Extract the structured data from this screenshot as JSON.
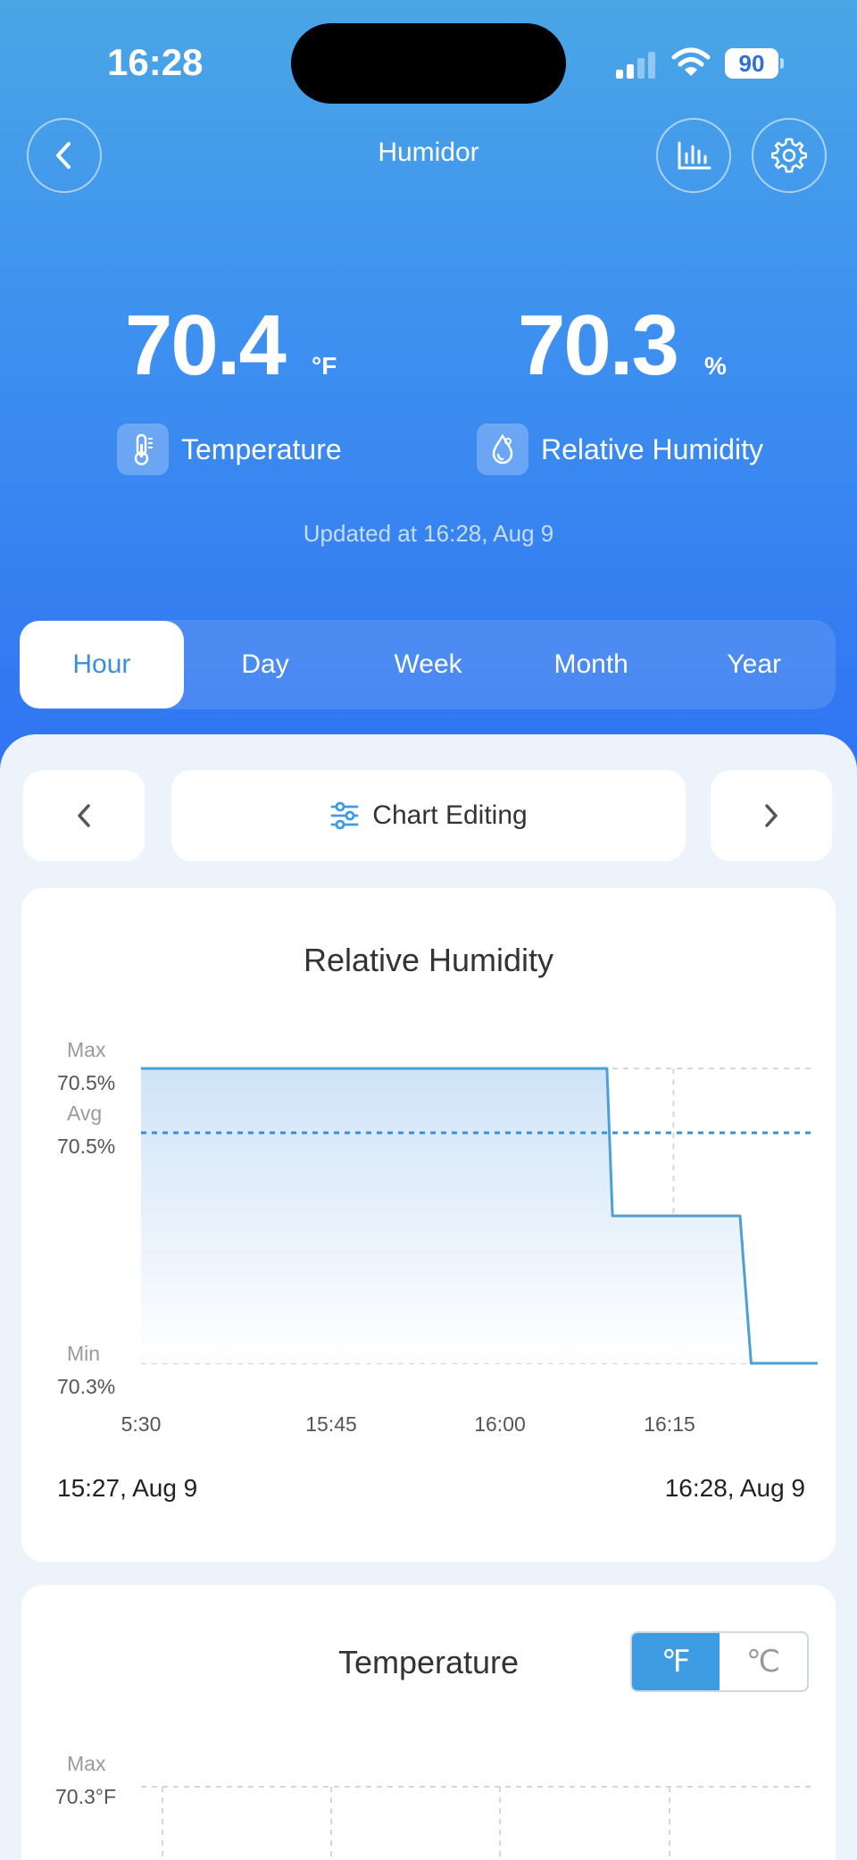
{
  "status_bar": {
    "time": "16:28",
    "battery": "90"
  },
  "nav": {
    "title": "Humidor",
    "icons": [
      "chevron-left-icon",
      "bar-chart-icon",
      "gear-icon"
    ]
  },
  "readings": {
    "temperature": {
      "value": "70.4",
      "unit": "°F",
      "label": "Temperature"
    },
    "humidity": {
      "value": "70.3",
      "unit": "%",
      "label": "Relative Humidity"
    }
  },
  "updated_text": "Updated at 16:28,  Aug 9",
  "tabs": [
    {
      "label": "Hour",
      "active": true
    },
    {
      "label": "Day",
      "active": false
    },
    {
      "label": "Week",
      "active": false
    },
    {
      "label": "Month",
      "active": false
    },
    {
      "label": "Year",
      "active": false
    }
  ],
  "toolbar": {
    "chart_editing_label": "Chart Editing"
  },
  "humidity_card": {
    "title": "Relative Humidity",
    "max_label": "Max",
    "max_value": "70.5%",
    "avg_label": "Avg",
    "avg_value": "70.5%",
    "min_label": "Min",
    "min_value": "70.3%",
    "start": "15:27,  Aug 9",
    "end": "16:28,  Aug 9"
  },
  "temperature_card": {
    "title": "Temperature",
    "unit_f": "℉",
    "unit_c": "℃",
    "max_label": "Max",
    "max_value": "70.3°F"
  },
  "colors": {
    "accent": "#3d9ce2",
    "hero_top": "#4aa6e6",
    "hero_bottom": "#2f73f2",
    "line": "#4aa0d8"
  },
  "chart_data": {
    "type": "line",
    "title": "Relative Humidity",
    "xlabel": "",
    "ylabel": "",
    "x_ticks": [
      "5:30",
      "15:45",
      "16:00",
      "16:15"
    ],
    "x": [
      "15:27",
      "16:09",
      "16:09.5",
      "16:21",
      "16:22",
      "16:28"
    ],
    "y": [
      70.5,
      70.5,
      70.4,
      70.4,
      70.3,
      70.3
    ],
    "max": 70.5,
    "avg": 70.5,
    "min": 70.3,
    "ylim": [
      70.3,
      70.5
    ],
    "grid": true
  }
}
